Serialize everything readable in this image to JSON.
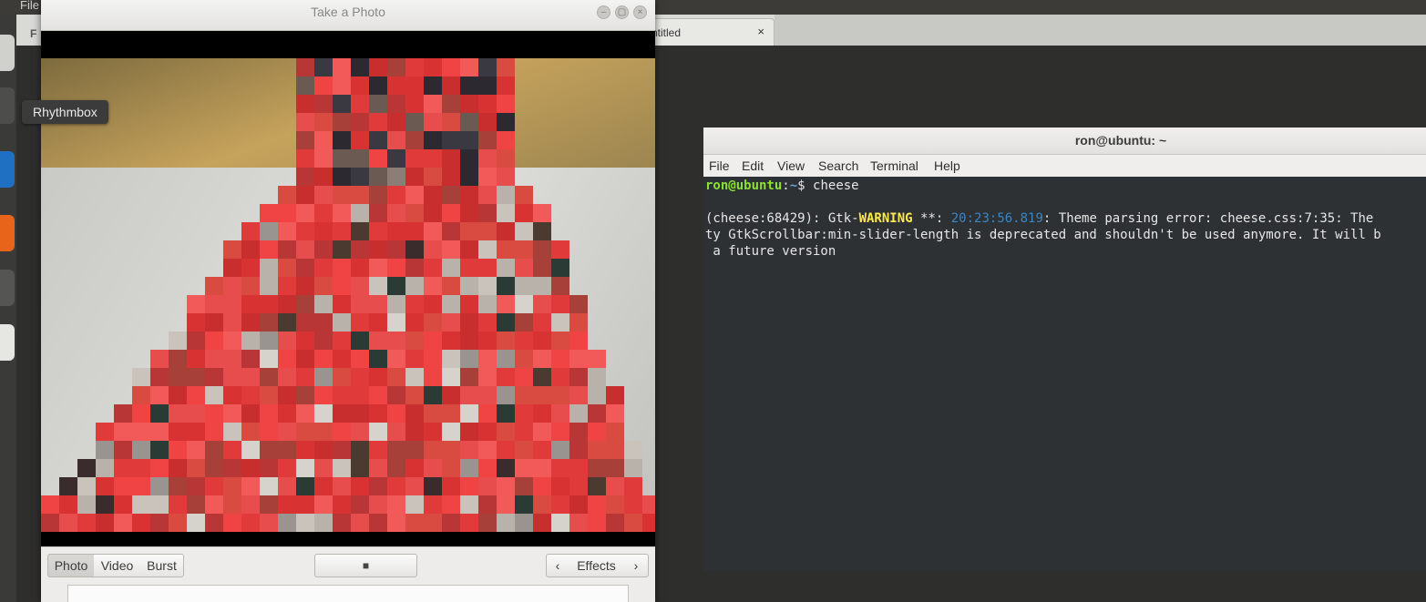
{
  "editor": {
    "menu_file": "File",
    "toolbar_fragment": "F",
    "tab_label": "ntitled",
    "tab_close": "×"
  },
  "launcher": {
    "tooltip": "Rhythmbox"
  },
  "cheese": {
    "title": "Take a Photo",
    "modes": [
      "Photo",
      "Video",
      "Burst"
    ],
    "shutter_icon": "■",
    "effects_label": "Effects",
    "prev_icon": "‹",
    "next_icon": "›",
    "minimize_icon": "–",
    "maximize_icon": "▢",
    "close_icon": "×"
  },
  "terminal": {
    "title": "ron@ubuntu: ~",
    "menu": [
      "File",
      "Edit",
      "View",
      "Search",
      "Terminal",
      "Help"
    ],
    "prompt_user": "ron@ubuntu",
    "prompt_sep": ":",
    "prompt_path": "~",
    "prompt_dollar": "$ ",
    "command": "cheese",
    "line1_a": "(cheese:68429): Gtk-",
    "line1_warning": "WARNING",
    "line1_b": " **: ",
    "line1_time": "20:23:56.819",
    "line1_c": ": Theme parsing error: cheese.css:7:35: The",
    "line2": "ty GtkScrollbar:min-slider-length is deprecated and shouldn't be used anymore. It will b",
    "line3": " a future version"
  }
}
